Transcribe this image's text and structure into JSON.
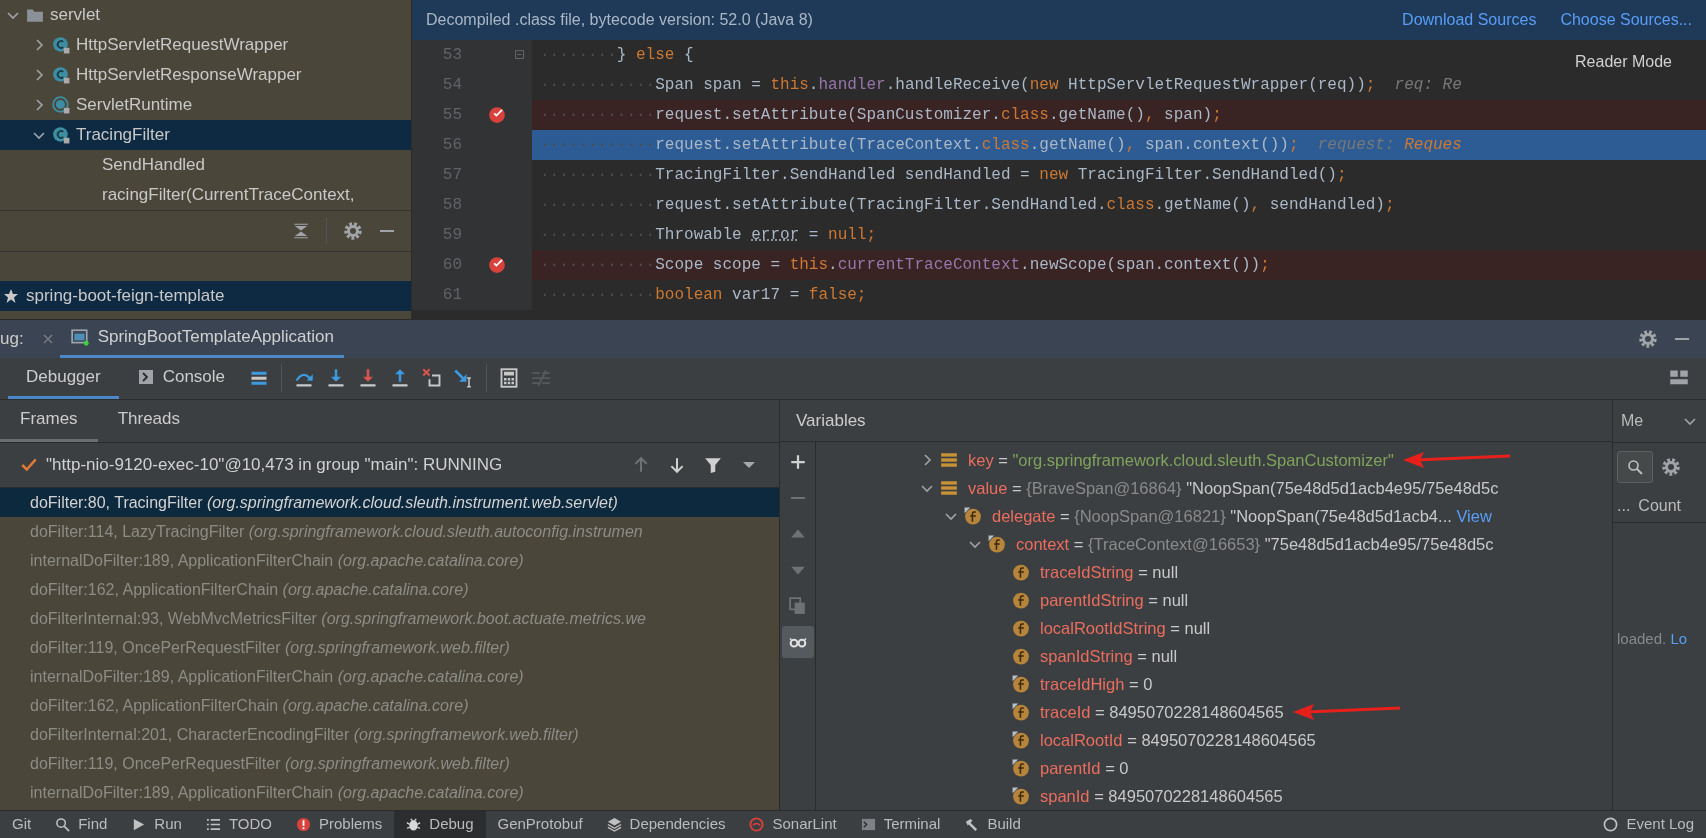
{
  "project_tree": {
    "items": [
      {
        "label": "servlet",
        "kind": "folder",
        "expanded": true,
        "selected": false,
        "children": [
          {
            "label": "HttpServletRequestWrapper",
            "kind": "class",
            "expanded": false,
            "selected": false
          },
          {
            "label": "HttpServletResponseWrapper",
            "kind": "class",
            "expanded": false,
            "selected": false
          },
          {
            "label": "ServletRuntime",
            "kind": "abstract-class",
            "expanded": false,
            "selected": false
          },
          {
            "label": "TracingFilter",
            "kind": "class",
            "expanded": true,
            "selected": true,
            "children": [
              {
                "label": "SendHandled",
                "selected": false
              },
              {
                "label": "racingFilter(CurrentTraceContext,",
                "selected": false
              }
            ]
          }
        ]
      }
    ]
  },
  "project_root": {
    "label": "spring-boot-feign-template",
    "selected": true
  },
  "editor": {
    "banner": {
      "text": "Decompiled .class file, bytecode version: 52.0 (Java 8)",
      "links": [
        "Download Sources",
        "Choose Sources..."
      ]
    },
    "reader_mode": "Reader Mode",
    "lines": [
      {
        "number": "53",
        "breakpoint": false,
        "fold": true,
        "current": false,
        "tokens": [
          {
            "kind": "ws",
            "t": "········"
          },
          {
            "kind": "plain",
            "t": "} "
          },
          {
            "kind": "kw",
            "t": "else"
          },
          {
            "kind": "plain",
            "t": " {"
          }
        ]
      },
      {
        "number": "54",
        "breakpoint": false,
        "fold": false,
        "current": false,
        "tokens": [
          {
            "kind": "ws",
            "t": "············"
          },
          {
            "kind": "plain",
            "t": "Span span = "
          },
          {
            "kind": "kw",
            "t": "this"
          },
          {
            "kind": "plain",
            "t": "."
          },
          {
            "kind": "field",
            "t": "handler"
          },
          {
            "kind": "plain",
            "t": ".handleReceive("
          },
          {
            "kind": "kw",
            "t": "new"
          },
          {
            "kind": "plain",
            "t": " HttpServletRequestWrapper(req))"
          },
          {
            "kind": "kw",
            "t": ";"
          },
          {
            "kind": "hint",
            "t": "  req: Re"
          }
        ]
      },
      {
        "number": "55",
        "breakpoint": true,
        "fold": false,
        "current": false,
        "tokens": [
          {
            "kind": "ws",
            "t": "············"
          },
          {
            "kind": "plain",
            "t": "request.setAttribute(SpanCustomizer."
          },
          {
            "kind": "kw",
            "t": "class"
          },
          {
            "kind": "plain",
            "t": ".getName()"
          },
          {
            "kind": "kw",
            "t": ","
          },
          {
            "kind": "plain",
            "t": " span)"
          },
          {
            "kind": "kw",
            "t": ";"
          }
        ]
      },
      {
        "number": "56",
        "breakpoint": false,
        "fold": false,
        "current": true,
        "tokens": [
          {
            "kind": "ws",
            "t": "············"
          },
          {
            "kind": "plain",
            "t": "request.setAttribute(TraceContext."
          },
          {
            "kind": "kw",
            "t": "class"
          },
          {
            "kind": "plain",
            "t": ".getName()"
          },
          {
            "kind": "kw",
            "t": ","
          },
          {
            "kind": "plain",
            "t": " span.context())"
          },
          {
            "kind": "kw",
            "t": ";"
          },
          {
            "kind": "hint",
            "t": "  request: "
          },
          {
            "kind": "hintval",
            "t": "Reques"
          }
        ]
      },
      {
        "number": "57",
        "breakpoint": false,
        "fold": false,
        "current": false,
        "tokens": [
          {
            "kind": "ws",
            "t": "············"
          },
          {
            "kind": "plain",
            "t": "TracingFilter.SendHandled sendHandled = "
          },
          {
            "kind": "kw",
            "t": "new"
          },
          {
            "kind": "plain",
            "t": " TracingFilter.SendHandled()"
          },
          {
            "kind": "kw",
            "t": ";"
          }
        ]
      },
      {
        "number": "58",
        "breakpoint": false,
        "fold": false,
        "current": false,
        "tokens": [
          {
            "kind": "ws",
            "t": "············"
          },
          {
            "kind": "plain",
            "t": "request.setAttribute(TracingFilter.SendHandled."
          },
          {
            "kind": "kw",
            "t": "class"
          },
          {
            "kind": "plain",
            "t": ".getName()"
          },
          {
            "kind": "kw",
            "t": ","
          },
          {
            "kind": "plain",
            "t": " sendHandled)"
          },
          {
            "kind": "kw",
            "t": ";"
          }
        ]
      },
      {
        "number": "59",
        "breakpoint": false,
        "fold": false,
        "current": false,
        "tokens": [
          {
            "kind": "ws",
            "t": "············"
          },
          {
            "kind": "plain",
            "t": "Throwable "
          },
          {
            "kind": "under",
            "t": "error"
          },
          {
            "kind": "plain",
            "t": " = "
          },
          {
            "kind": "kw",
            "t": "null;"
          }
        ]
      },
      {
        "number": "60",
        "breakpoint": true,
        "fold": false,
        "current": false,
        "tokens": [
          {
            "kind": "ws",
            "t": "············"
          },
          {
            "kind": "plain",
            "t": "Scope scope = "
          },
          {
            "kind": "kw",
            "t": "this"
          },
          {
            "kind": "plain",
            "t": "."
          },
          {
            "kind": "field",
            "t": "currentTraceContext"
          },
          {
            "kind": "plain",
            "t": ".newScope(span.context())"
          },
          {
            "kind": "kw",
            "t": ";"
          }
        ]
      },
      {
        "number": "61",
        "breakpoint": false,
        "fold": false,
        "current": false,
        "tokens": [
          {
            "kind": "ws",
            "t": "············"
          },
          {
            "kind": "kw",
            "t": "boolean"
          },
          {
            "kind": "plain",
            "t": " var17 = "
          },
          {
            "kind": "kw",
            "t": "false;"
          }
        ]
      }
    ]
  },
  "debug": {
    "label": "ug:",
    "tabs": [
      {
        "label": "SpringBootTemplateApplication",
        "selected": true
      }
    ],
    "view_tabs": [
      {
        "label": "Debugger",
        "selected": true
      },
      {
        "label": "Console",
        "selected": false
      }
    ],
    "toolbar": [
      {
        "kind": "frames-menu",
        "disabled": false
      },
      {
        "kind": "step-over",
        "disabled": false
      },
      {
        "kind": "step-into",
        "disabled": false
      },
      {
        "kind": "force-step-into",
        "disabled": false
      },
      {
        "kind": "step-out",
        "disabled": false
      },
      {
        "kind": "drop-frame",
        "disabled": false
      },
      {
        "kind": "run-to-cursor",
        "disabled": false
      },
      {
        "kind": "evaluate",
        "disabled": false
      },
      {
        "kind": "trace",
        "disabled": true
      }
    ]
  },
  "frames": {
    "tabs": [
      {
        "label": "Frames",
        "selected": true
      },
      {
        "label": "Threads",
        "selected": false
      }
    ],
    "thread": "\"http-nio-9120-exec-10\"@10,473 in group \"main\": RUNNING",
    "nav": [
      {
        "kind": "up",
        "disabled": true
      },
      {
        "kind": "down",
        "disabled": false
      },
      {
        "kind": "filter",
        "disabled": false
      },
      {
        "kind": "dropdown",
        "disabled": false
      }
    ],
    "items": [
      {
        "method": "doFilter:80, TracingFilter",
        "package": "(org.springframework.cloud.sleuth.instrument.web.servlet)",
        "selected": true,
        "dimmed": false
      },
      {
        "method": "doFilter:114, LazyTracingFilter",
        "package": "(org.springframework.cloud.sleuth.autoconfig.instrumen",
        "selected": false,
        "dimmed": true
      },
      {
        "method": "internalDoFilter:189, ApplicationFilterChain",
        "package": "(org.apache.catalina.core)",
        "selected": false,
        "dimmed": true
      },
      {
        "method": "doFilter:162, ApplicationFilterChain",
        "package": "(org.apache.catalina.core)",
        "selected": false,
        "dimmed": true
      },
      {
        "method": "doFilterInternal:93, WebMvcMetricsFilter",
        "package": "(org.springframework.boot.actuate.metrics.we",
        "selected": false,
        "dimmed": true
      },
      {
        "method": "doFilter:119, OncePerRequestFilter",
        "package": "(org.springframework.web.filter)",
        "selected": false,
        "dimmed": true
      },
      {
        "method": "internalDoFilter:189, ApplicationFilterChain",
        "package": "(org.apache.catalina.core)",
        "selected": false,
        "dimmed": true
      },
      {
        "method": "doFilter:162, ApplicationFilterChain",
        "package": "(org.apache.catalina.core)",
        "selected": false,
        "dimmed": true
      },
      {
        "method": "doFilterInternal:201, CharacterEncodingFilter",
        "package": "(org.springframework.web.filter)",
        "selected": false,
        "dimmed": true
      },
      {
        "method": "doFilter:119, OncePerRequestFilter",
        "package": "(org.springframework.web.filter)",
        "selected": false,
        "dimmed": true
      },
      {
        "method": "internalDoFilter:189, ApplicationFilterChain",
        "package": "(org.apache.catalina.core)",
        "selected": false,
        "dimmed": true
      }
    ]
  },
  "variables": {
    "title": "Variables",
    "side_tools": [
      {
        "kind": "add",
        "disabled": false,
        "selected": false
      },
      {
        "kind": "remove",
        "disabled": true,
        "selected": false
      },
      {
        "kind": "up",
        "disabled": true,
        "selected": false
      },
      {
        "kind": "down",
        "disabled": true,
        "selected": false
      },
      {
        "kind": "copy",
        "disabled": true,
        "selected": false
      },
      {
        "kind": "glasses",
        "disabled": false,
        "selected": true
      }
    ],
    "items": [
      {
        "name": "key",
        "kind": "entry",
        "expanded": false,
        "sign": "=",
        "value": "\"org.springframework.cloud.sleuth.SpanCustomizer\"",
        "string": true,
        "marked": true
      },
      {
        "name": "value",
        "kind": "entry",
        "expanded": true,
        "sign": "=",
        "type": "{BraveSpan@16864}",
        "value": "\"NoopSpan(75e48d5d1acb4e95/75e48d5c",
        "string": false,
        "marked": false,
        "children": [
          {
            "name": "delegate",
            "kind": "field-final",
            "expanded": true,
            "sign": "=",
            "type": "{NoopSpan@16821}",
            "value": "\"NoopSpan(75e48d5d1acb4...",
            "link": "View",
            "string": false,
            "marked": false,
            "children": [
              {
                "name": "context",
                "kind": "field-final",
                "expanded": true,
                "sign": "=",
                "type": "{TraceContext@16653}",
                "value": "\"75e48d5d1acb4e95/75e48d5c",
                "string": false,
                "marked": false,
                "children": [
                  {
                    "name": "traceIdString",
                    "kind": "field",
                    "sign": "=",
                    "value": "null",
                    "string": false,
                    "marked": false
                  },
                  {
                    "name": "parentIdString",
                    "kind": "field",
                    "sign": "=",
                    "value": "null",
                    "string": false,
                    "marked": false
                  },
                  {
                    "name": "localRootIdString",
                    "kind": "field",
                    "sign": "=",
                    "value": "null",
                    "string": false,
                    "marked": false
                  },
                  {
                    "name": "spanIdString",
                    "kind": "field",
                    "sign": "=",
                    "value": "null",
                    "string": false,
                    "marked": false
                  },
                  {
                    "name": "traceIdHigh",
                    "kind": "field-final",
                    "sign": "=",
                    "value": "0",
                    "string": false,
                    "marked": false
                  },
                  {
                    "name": "traceId",
                    "kind": "field-final",
                    "sign": "=",
                    "value": "8495070228148604565",
                    "string": false,
                    "marked": true
                  },
                  {
                    "name": "localRootId",
                    "kind": "field-final",
                    "sign": "=",
                    "value": "8495070228148604565",
                    "string": false,
                    "marked": false
                  },
                  {
                    "name": "parentId",
                    "kind": "field-final",
                    "sign": "=",
                    "value": "0",
                    "string": false,
                    "marked": false
                  },
                  {
                    "name": "spanId",
                    "kind": "field-final",
                    "sign": "=",
                    "value": "8495070228148604565",
                    "string": false,
                    "marked": false
                  }
                ]
              }
            ]
          }
        ]
      }
    ]
  },
  "memory": {
    "tab": "Me",
    "ellipsis": "...",
    "column": "Count",
    "status": "loaded.",
    "link": "Lo"
  },
  "bottom_bar": [
    {
      "label": "Git",
      "selected": false
    },
    {
      "label": "Find",
      "kind": "search",
      "selected": false
    },
    {
      "label": "Run",
      "kind": "run",
      "selected": false
    },
    {
      "label": "TODO",
      "kind": "list",
      "selected": false
    },
    {
      "label": "Problems",
      "kind": "problems",
      "selected": false
    },
    {
      "label": "Debug",
      "kind": "bug",
      "selected": true
    },
    {
      "label": "GenProtobuf",
      "selected": false
    },
    {
      "label": "Dependencies",
      "kind": "stack",
      "selected": false
    },
    {
      "label": "SonarLint",
      "kind": "sonar",
      "selected": false
    },
    {
      "label": "Terminal",
      "kind": "terminal",
      "selected": false
    },
    {
      "label": "Build",
      "kind": "hammer",
      "selected": false
    },
    {
      "label": "Event Log",
      "kind": "log",
      "selected": false
    }
  ]
}
